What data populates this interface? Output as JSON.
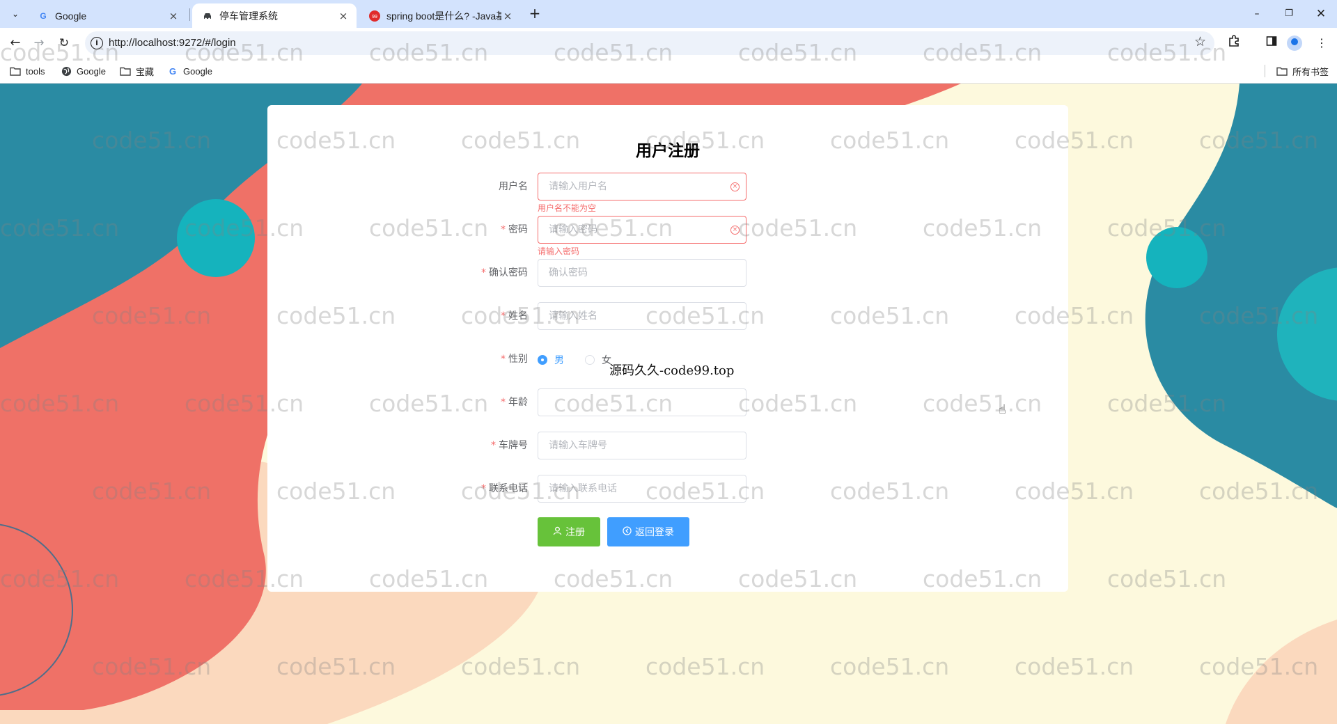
{
  "browser": {
    "tabs": [
      {
        "title": "Google",
        "close": "×"
      },
      {
        "title": "停车管理系统",
        "close": "×"
      },
      {
        "title": "spring boot是什么? -Java基础",
        "close": "×"
      }
    ],
    "new_tab": "+",
    "url": "http://localhost:9272/#/login",
    "bookmarks": [
      {
        "label": "tools"
      },
      {
        "label": "Google"
      },
      {
        "label": "宝藏"
      },
      {
        "label": "Google"
      }
    ],
    "all_bookmarks": "所有书签"
  },
  "form": {
    "title": "用户注册",
    "fields": {
      "username": {
        "label": "用户名",
        "placeholder": "请输入用户名",
        "error": "用户名不能为空"
      },
      "password": {
        "label": "密码",
        "placeholder": "请输入密码",
        "error": "请输入密码"
      },
      "confirm": {
        "label": "确认密码",
        "placeholder": "确认密码"
      },
      "name": {
        "label": "姓名",
        "placeholder": "请输入姓名"
      },
      "gender": {
        "label": "性别",
        "options": [
          "男",
          "女"
        ],
        "selected": "男"
      },
      "age": {
        "label": "年龄",
        "placeholder": ""
      },
      "plate": {
        "label": "车牌号",
        "placeholder": "请输入车牌号"
      },
      "phone": {
        "label": "联系电话",
        "placeholder": "请输入联系电话"
      }
    },
    "buttons": {
      "register": "注册",
      "back": "返回登录"
    }
  },
  "overlay_text": "源码久久-code99.top",
  "watermark": "code51.cn",
  "colors": {
    "teal": "#2a8ba3",
    "coral": "#ef7167",
    "peach": "#fbd9be",
    "cream": "#fdf9dd",
    "cyan": "#15b3bd",
    "success": "#67c23a",
    "primary": "#409eff",
    "danger": "#f56c6c"
  }
}
